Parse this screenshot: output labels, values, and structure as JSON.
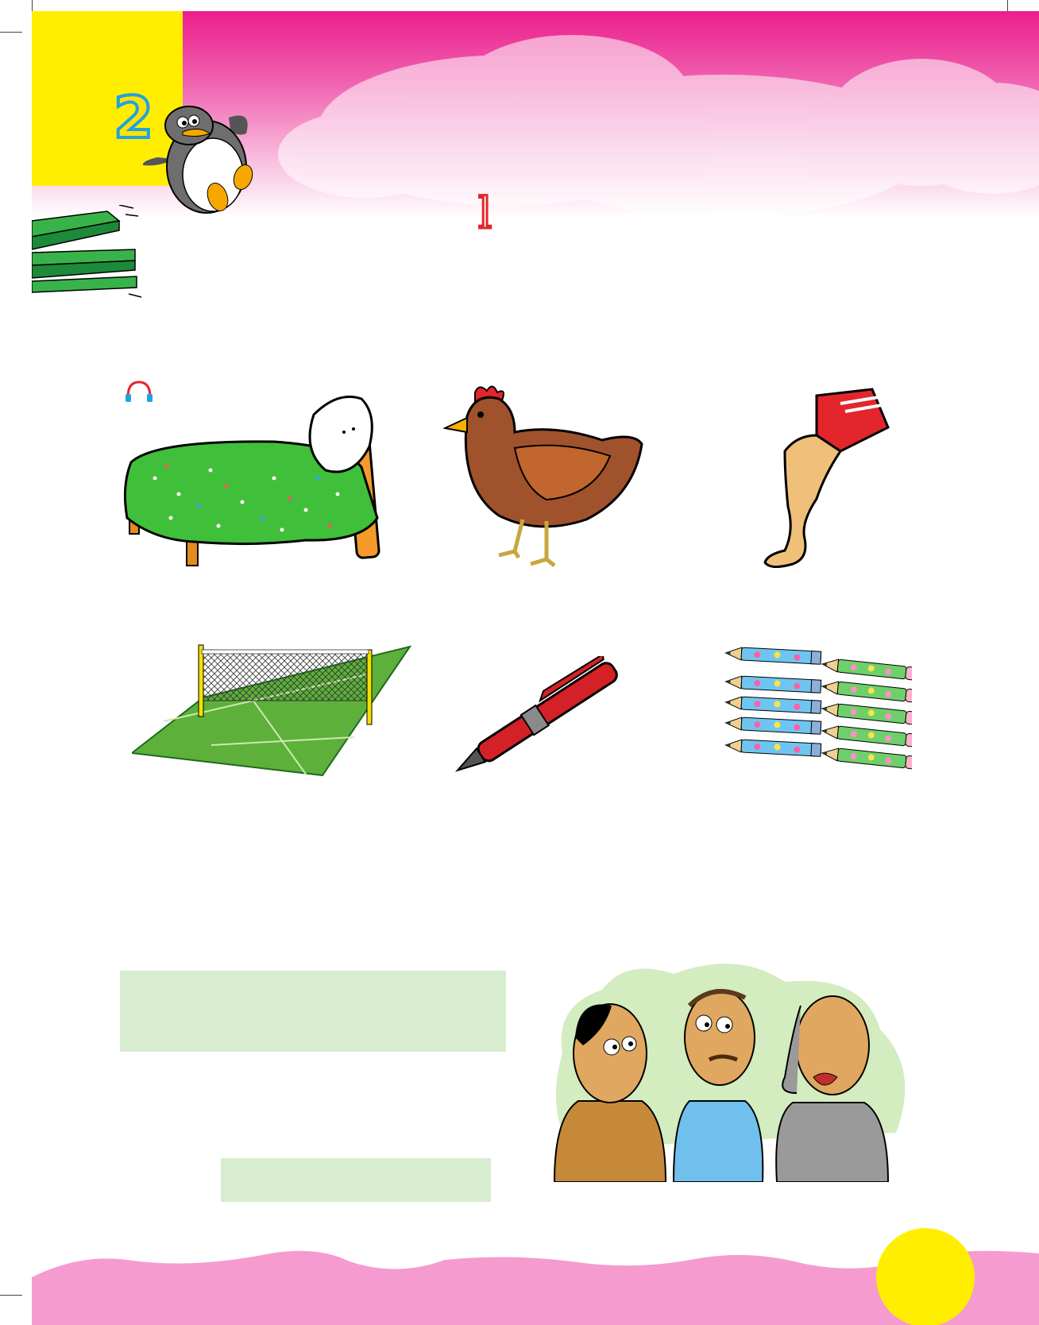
{
  "page": {
    "chapter_number": "2",
    "title_glyph": "l"
  },
  "illustrations": [
    {
      "name": "bed-image"
    },
    {
      "name": "hen-image"
    },
    {
      "name": "leg-image"
    },
    {
      "name": "tennis-court-image"
    },
    {
      "name": "pen-image"
    },
    {
      "name": "colour-pencils-image"
    }
  ],
  "icons": {
    "listen": "headphones-icon",
    "mascot": "penguin-icon"
  },
  "colors": {
    "header_pink": "#ec1e8c",
    "footer_pink": "#f59bd0",
    "sun_yellow": "#ffee00",
    "answer_box_green": "#d8ecd0",
    "title_red": "#e3262c"
  }
}
